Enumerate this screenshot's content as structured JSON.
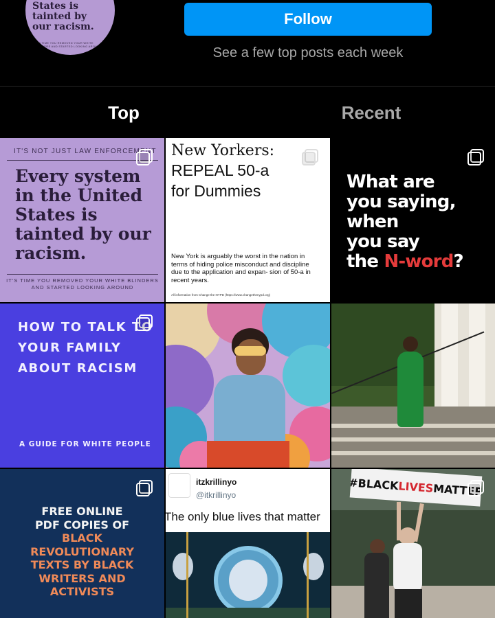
{
  "header": {
    "avatar_text": "States is tainted by our racism.",
    "avatar_small": "IT'S TIME YOU REMOVED YOUR WHITE BLINDERS AND STARTED LOOKING AROUND",
    "follow_label": "Follow",
    "subline": "See a few top posts each week"
  },
  "tabs": [
    {
      "label": "Top",
      "active": true
    },
    {
      "label": "Recent",
      "active": false
    }
  ],
  "posts": [
    {
      "top_line": "IT'S NOT JUST LAW ENFORCEMENT",
      "headline": "Every system in the United States is tainted by our racism.",
      "footer": "IT'S TIME YOU REMOVED YOUR WHITE BLINDERS AND STARTED LOOKING AROUND",
      "icon": "multiple-posts-icon"
    },
    {
      "line1": "New Yorkers:",
      "line2": "REPEAL 50-a",
      "line3": "for Dummies",
      "body": "New York is arguably the worst in the nation in terms of hiding police misconduct and discipline due to the application and expan- sion of 50-a in recent years.",
      "small": "All information from Change the NYPD (https://www.changethenypd.org)",
      "icon": "multiple-posts-icon"
    },
    {
      "line1": "What are",
      "line2": "you saying,",
      "line3": "when",
      "line4": "you say",
      "line5a": "the ",
      "line5b": "N-word",
      "line5c": "?",
      "icon": "multiple-posts-icon"
    },
    {
      "headline": "HOW TO TALK TO YOUR FAMILY ABOUT RACISM",
      "sub": "A GUIDE FOR WHITE PEOPLE",
      "icon": "multiple-posts-icon"
    },
    {
      "description": "balloon-photo"
    },
    {
      "description": "staircase-photo"
    },
    {
      "l1": "FREE ONLINE",
      "l2": "PDF COPIES OF",
      "l3": "BLACK",
      "l4": "REVOLUTIONARY",
      "l5": "TEXTS BY BLACK",
      "l6": "WRITERS AND",
      "l7": "ACTIVISTS",
      "icon": "multiple-posts-icon"
    },
    {
      "name": "itzkrillinyo",
      "handle": "@itkrillinyo",
      "text": "The only blue lives that matter",
      "icon": "multiple-posts-icon"
    },
    {
      "sign_a": "#BLACK",
      "sign_b": "LIVES",
      "sign_c": "MATTER",
      "icon": "multiple-posts-icon"
    }
  ],
  "colors": {
    "follow_blue": "#0095f6",
    "tile1_lavender": "#b69bd6",
    "tile4_blue": "#4a3fe0",
    "tile7_navy": "#12305a",
    "nword_red": "#e53b3b"
  }
}
